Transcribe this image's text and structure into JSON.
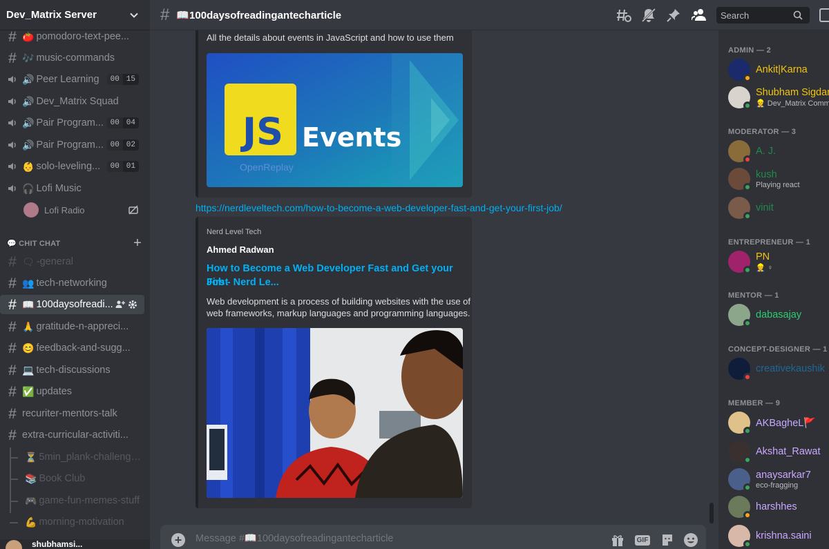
{
  "server": {
    "name": "Dev_Matrix Server"
  },
  "channels_top": [
    {
      "kind": "text",
      "emoji": "🍅",
      "label": "pomodoro-text-pee..."
    },
    {
      "kind": "text",
      "emoji": "🎶",
      "label": "music-commands"
    },
    {
      "kind": "voice",
      "emoji": "🔊",
      "label": "Peer Learning",
      "counts": [
        "00",
        "15"
      ]
    },
    {
      "kind": "voice",
      "emoji": "🔊",
      "label": "Dev_Matrix Squad"
    },
    {
      "kind": "voice",
      "emoji": "🔊",
      "label": "Pair Program...",
      "counts": [
        "00",
        "04"
      ]
    },
    {
      "kind": "voice",
      "emoji": "🔊",
      "label": "Pair Program...",
      "counts": [
        "00",
        "02"
      ]
    },
    {
      "kind": "voice",
      "emoji": "👶",
      "label": "solo-leveling...",
      "counts": [
        "00",
        "01"
      ]
    },
    {
      "kind": "voice",
      "emoji": "🎧",
      "label": "Lofi Music"
    }
  ],
  "voice_user": {
    "name": "Lofi Radio"
  },
  "category": {
    "label": "💬 CHIT CHAT",
    "add": "+"
  },
  "channels_chat": [
    {
      "kind": "text",
      "emoji": "🗨",
      "label": "-general",
      "dim": true
    },
    {
      "kind": "text",
      "emoji": "👥",
      "label": "tech-networking"
    },
    {
      "kind": "text",
      "emoji": "📖",
      "label": "100daysofreadi...",
      "active": true
    },
    {
      "kind": "text",
      "emoji": "🙏",
      "label": "gratitude-n-appreci..."
    },
    {
      "kind": "text",
      "emoji": "😊",
      "label": "feedback-and-sugg..."
    },
    {
      "kind": "text",
      "emoji": "💻",
      "label": "tech-discussions"
    },
    {
      "kind": "text",
      "emoji": "✅",
      "label": "updates"
    },
    {
      "kind": "forum",
      "emoji": "",
      "label": "recuriter-mentors-talk"
    },
    {
      "kind": "forum",
      "emoji": "",
      "label": "extra-curricular-activiti..."
    }
  ],
  "threads": [
    {
      "emoji": "⏳",
      "label": "5min_plank-challenge..."
    },
    {
      "emoji": "📚",
      "label": "Book Club"
    },
    {
      "emoji": "🎮",
      "label": "game-fun-memes-stuff"
    },
    {
      "emoji": "💪",
      "label": "morning-motivation"
    }
  ],
  "user": {
    "name": "shubhamsi..."
  },
  "header": {
    "channel_title": "📖100daysofreadingantecharticle",
    "search_placeholder": "Search"
  },
  "messages": {
    "embed1": {
      "description": "All the details about events in JavaScript and how to use them",
      "image": {
        "badge": "JS",
        "word": "Events",
        "brand": "OpenReplay"
      }
    },
    "link2": "https://nerdleveltech.com/how-to-become-a-web-developer-fast-and-get-your-first-job/",
    "embed2": {
      "provider": "Nerd Level Tech",
      "author": "Ahmed Radwan",
      "title_line1": "How to Become a Web Developer Fast and Get your First",
      "title_line2": "Job - Nerd Le...",
      "desc_line1": "Web development is a process of building websites with the use of",
      "desc_line2": "web frameworks, markup languages and programming languages."
    }
  },
  "composer": {
    "placeholder": "Message #📖100daysofreadingantecharticle",
    "gif": "GIF"
  },
  "members": {
    "groups": [
      {
        "label": "ADMIN — 2"
      },
      {
        "label": "MODERATOR — 3"
      },
      {
        "label": "ENTREPRENEUR — 1"
      },
      {
        "label": "MENTOR — 1"
      },
      {
        "label": "CONCEPT-DESIGNER — 1"
      },
      {
        "label": "MEMBER — 9"
      }
    ],
    "list": [
      {
        "name": "Ankit|Karna",
        "color": "#f1c40f",
        "status": "idle",
        "avatar": "#1b2a6b"
      },
      {
        "name": "Shubham Sigdar",
        "color": "#f1c40f",
        "sub": "👷 Dev_Matrix Comm",
        "status": "online",
        "avatar": "#d8d3cc"
      },
      {
        "name": "A. J.",
        "color": "#1f8b4c",
        "status": "dnd",
        "avatar": "#8a6b3a"
      },
      {
        "name": "kush",
        "color": "#1f8b4c",
        "sub": "Playing react",
        "status": "online",
        "avatar": "#6b4a3a"
      },
      {
        "name": "vinit",
        "color": "#1f8b4c",
        "status": "online",
        "avatar": "#7a5a48"
      },
      {
        "name": "PN",
        "color": "#f1c40f",
        "sub": "👷 ♀",
        "status": "online",
        "avatar": "#a0226a"
      },
      {
        "name": "dabasajay",
        "color": "#2ecc71",
        "status": "online",
        "avatar": "#8ba68a"
      },
      {
        "name": "creativekaushik",
        "color": "#206694",
        "status": "dnd",
        "avatar": "#0f1d3a"
      },
      {
        "name": "AKBagheL🚩",
        "color": "#c9a8ff",
        "status": "online",
        "avatar": "#e0c18a"
      },
      {
        "name": "Akshat_Rawat",
        "color": "#c9a8ff",
        "status": "online",
        "avatar": "#3a3030"
      },
      {
        "name": "anaysarkar7",
        "color": "#c9a8ff",
        "sub": "eco-fragging",
        "status": "online",
        "avatar": "#4a5f8a"
      },
      {
        "name": "harshhes",
        "color": "#c9a8ff",
        "status": "idle",
        "avatar": "#6a7a5a"
      },
      {
        "name": "krishna.saini",
        "color": "#c9a8ff",
        "status": "online",
        "avatar": "#d8b8a8"
      }
    ]
  }
}
